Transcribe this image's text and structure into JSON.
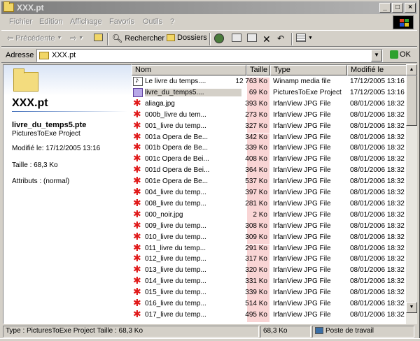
{
  "window": {
    "title": "XXX.pt",
    "menu": [
      "Fichier",
      "Edition",
      "Affichage",
      "Favoris",
      "Outils",
      "?"
    ]
  },
  "toolbar": {
    "back": "Précédente",
    "search": "Rechercher",
    "folders": "Dossiers"
  },
  "address": {
    "label": "Adresse",
    "value": "XXX.pt",
    "go": "OK"
  },
  "details": {
    "folder_title": "XXX.pt",
    "file_name": "livre_du_temps5.pte",
    "file_type": "PicturesToExe Project",
    "modified": "Modifié le: 17/12/2005 13:16",
    "size": "Taille : 68,3 Ko",
    "attributes": "Attributs : (normal)"
  },
  "columns": {
    "name": "Nom",
    "size": "Taille",
    "type": "Type",
    "modified": "Modifié le"
  },
  "files": [
    {
      "icon": "winamp-icon",
      "name": "Le livre du temps....",
      "size": "12 763 Ko",
      "type": "Winamp media file",
      "date": "17/12/2005 13:16"
    },
    {
      "icon": "pte-icon",
      "name": "livre_du_temps5....",
      "size": "69 Ko",
      "type": "PicturesToExe Project",
      "date": "17/12/2005 13:16"
    },
    {
      "icon": "irfanview-icon",
      "name": "aliaga.jpg",
      "size": "393 Ko",
      "type": "IrfanView JPG File",
      "date": "08/01/2006 18:32"
    },
    {
      "icon": "irfanview-icon",
      "name": "000b_livre du tem...",
      "size": "273 Ko",
      "type": "IrfanView JPG File",
      "date": "08/01/2006 18:32"
    },
    {
      "icon": "irfanview-icon",
      "name": "001_livre du temp...",
      "size": "327 Ko",
      "type": "IrfanView JPG File",
      "date": "08/01/2006 18:32"
    },
    {
      "icon": "irfanview-icon",
      "name": "001a Opera de Be...",
      "size": "342 Ko",
      "type": "IrfanView JPG File",
      "date": "08/01/2006 18:32"
    },
    {
      "icon": "irfanview-icon",
      "name": "001b Opera de Be...",
      "size": "339 Ko",
      "type": "IrfanView JPG File",
      "date": "08/01/2006 18:32"
    },
    {
      "icon": "irfanview-icon",
      "name": "001c Opera de Bei...",
      "size": "408 Ko",
      "type": "IrfanView JPG File",
      "date": "08/01/2006 18:32"
    },
    {
      "icon": "irfanview-icon",
      "name": "001d Opera de Bei...",
      "size": "364 Ko",
      "type": "IrfanView JPG File",
      "date": "08/01/2006 18:32"
    },
    {
      "icon": "irfanview-icon",
      "name": "001e Opera de Be...",
      "size": "537 Ko",
      "type": "IrfanView JPG File",
      "date": "08/01/2006 18:32"
    },
    {
      "icon": "irfanview-icon",
      "name": "004_livre du temp...",
      "size": "397 Ko",
      "type": "IrfanView JPG File",
      "date": "08/01/2006 18:32"
    },
    {
      "icon": "irfanview-icon",
      "name": "008_livre du temp...",
      "size": "281 Ko",
      "type": "IrfanView JPG File",
      "date": "08/01/2006 18:32"
    },
    {
      "icon": "irfanview-icon",
      "name": "000_noir.jpg",
      "size": "2 Ko",
      "type": "IrfanView JPG File",
      "date": "08/01/2006 18:32"
    },
    {
      "icon": "irfanview-icon",
      "name": "009_livre du temp...",
      "size": "308 Ko",
      "type": "IrfanView JPG File",
      "date": "08/01/2006 18:32"
    },
    {
      "icon": "irfanview-icon",
      "name": "010_livre du temp...",
      "size": "309 Ko",
      "type": "IrfanView JPG File",
      "date": "08/01/2006 18:32"
    },
    {
      "icon": "irfanview-icon",
      "name": "011_livre du temp...",
      "size": "291 Ko",
      "type": "IrfanView JPG File",
      "date": "08/01/2006 18:32"
    },
    {
      "icon": "irfanview-icon",
      "name": "012_livre du temp...",
      "size": "317 Ko",
      "type": "IrfanView JPG File",
      "date": "08/01/2006 18:32"
    },
    {
      "icon": "irfanview-icon",
      "name": "013_livre du temp...",
      "size": "320 Ko",
      "type": "IrfanView JPG File",
      "date": "08/01/2006 18:32"
    },
    {
      "icon": "irfanview-icon",
      "name": "014_livre du temp...",
      "size": "331 Ko",
      "type": "IrfanView JPG File",
      "date": "08/01/2006 18:32"
    },
    {
      "icon": "irfanview-icon",
      "name": "015_livre du temp...",
      "size": "339 Ko",
      "type": "IrfanView JPG File",
      "date": "08/01/2006 18:32"
    },
    {
      "icon": "irfanview-icon",
      "name": "016_livre du temp...",
      "size": "514 Ko",
      "type": "IrfanView JPG File",
      "date": "08/01/2006 18:32"
    },
    {
      "icon": "irfanview-icon",
      "name": "017_livre du temp...",
      "size": "495 Ko",
      "type": "IrfanView JPG File",
      "date": "08/01/2006 18:32"
    }
  ],
  "selected_index": 1,
  "status": {
    "info": "Type : PicturesToExe Project Taille : 68,3 Ko",
    "size": "68,3 Ko",
    "zone": "Poste de travail"
  }
}
